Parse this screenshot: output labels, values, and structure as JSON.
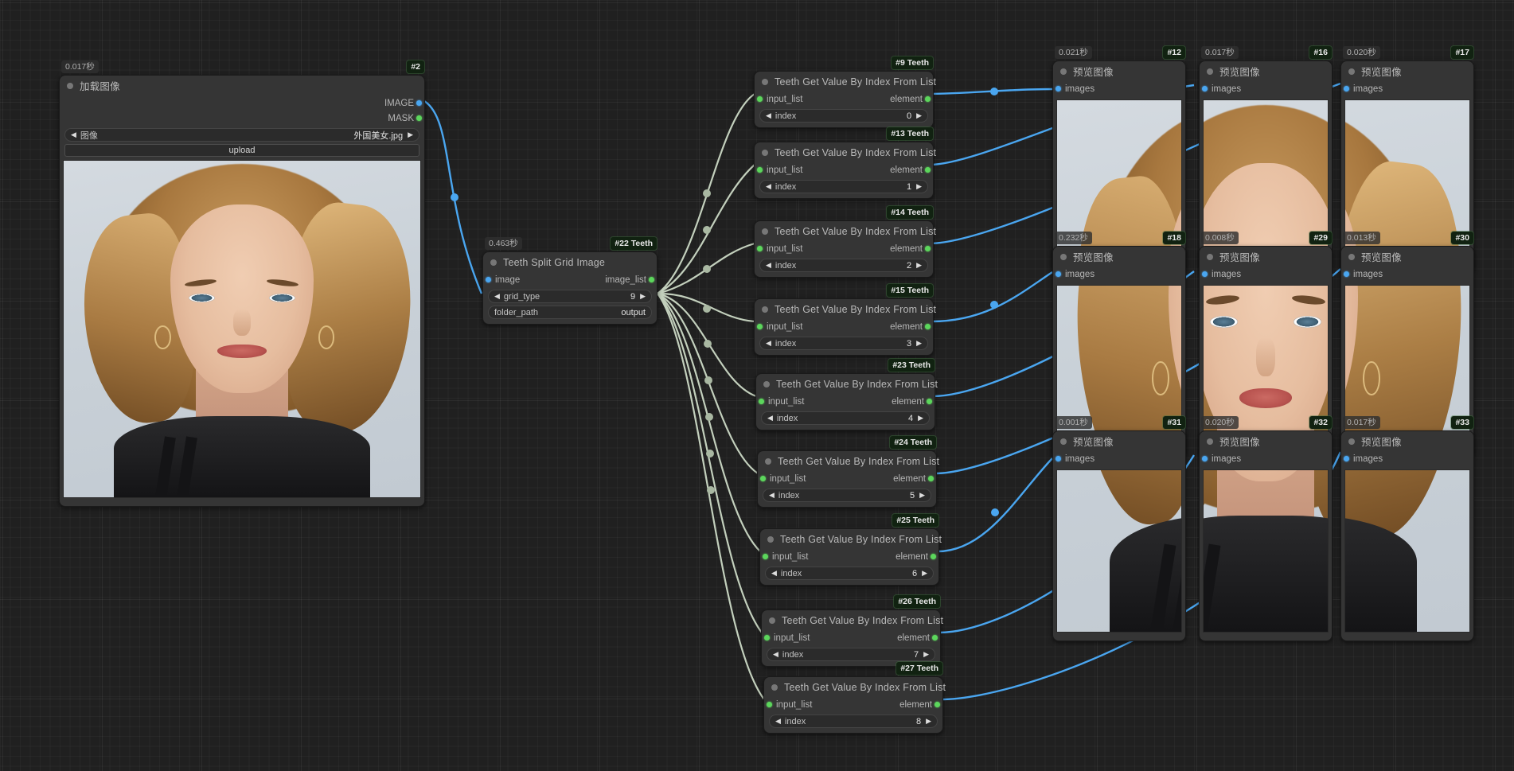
{
  "app": {
    "canvas_background": "#202020",
    "link_color_image": "#4aa6f0",
    "link_color_list": "#c3d0bd",
    "badge_color": "#112211"
  },
  "nodes": {
    "load_image": {
      "id_badge": "#2",
      "exec_time": "0.017秒",
      "title": "加载图像",
      "outputs": [
        {
          "label": "IMAGE",
          "type": "IMAGE"
        },
        {
          "label": "MASK",
          "type": "MASK"
        }
      ],
      "widget_image": {
        "name": "图像",
        "value": "外国美女.jpg",
        "arrow_left": "◀",
        "arrow_right": "▶"
      },
      "upload_button": "upload"
    },
    "split_grid": {
      "id_badge": "#22 Teeth",
      "exec_time": "0.463秒",
      "title": "Teeth Split Grid Image",
      "input": {
        "label": "image",
        "type": "IMAGE"
      },
      "output": {
        "label": "image_list",
        "type": "IMAGE_LIST"
      },
      "widget_grid_type": {
        "name": "grid_type",
        "value": "9",
        "arrow_left": "◀",
        "arrow_right": "▶"
      },
      "widget_folder_path": {
        "name": "folder_path",
        "value": "output"
      }
    },
    "get_value_title": "Teeth Get Value By Index From List",
    "get_value_input_label": "input_list",
    "get_value_output_label": "element",
    "get_value_index_label": "index",
    "get_value_nodes": [
      {
        "id_badge": "#9 Teeth",
        "index": "0"
      },
      {
        "id_badge": "#13 Teeth",
        "index": "1"
      },
      {
        "id_badge": "#14 Teeth",
        "index": "2"
      },
      {
        "id_badge": "#15 Teeth",
        "index": "3"
      },
      {
        "id_badge": "#23 Teeth",
        "index": "4"
      },
      {
        "id_badge": "#24 Teeth",
        "index": "5"
      },
      {
        "id_badge": "#25 Teeth",
        "index": "6"
      },
      {
        "id_badge": "#26 Teeth",
        "index": "7"
      },
      {
        "id_badge": "#27 Teeth",
        "index": "8"
      }
    ],
    "preview_title": "预览图像",
    "preview_input_label": "images",
    "preview_nodes": [
      {
        "id_badge": "#12",
        "exec_time": "0.021秒"
      },
      {
        "id_badge": "#16",
        "exec_time": "0.017秒"
      },
      {
        "id_badge": "#17",
        "exec_time": "0.020秒"
      },
      {
        "id_badge": "#18",
        "exec_time": "0.232秒"
      },
      {
        "id_badge": "#29",
        "exec_time": "0.008秒"
      },
      {
        "id_badge": "#30",
        "exec_time": "0.013秒"
      },
      {
        "id_badge": "#31",
        "exec_time": "0.001秒"
      },
      {
        "id_badge": "#32",
        "exec_time": "0.020秒"
      },
      {
        "id_badge": "#33",
        "exec_time": "0.017秒"
      }
    ]
  }
}
